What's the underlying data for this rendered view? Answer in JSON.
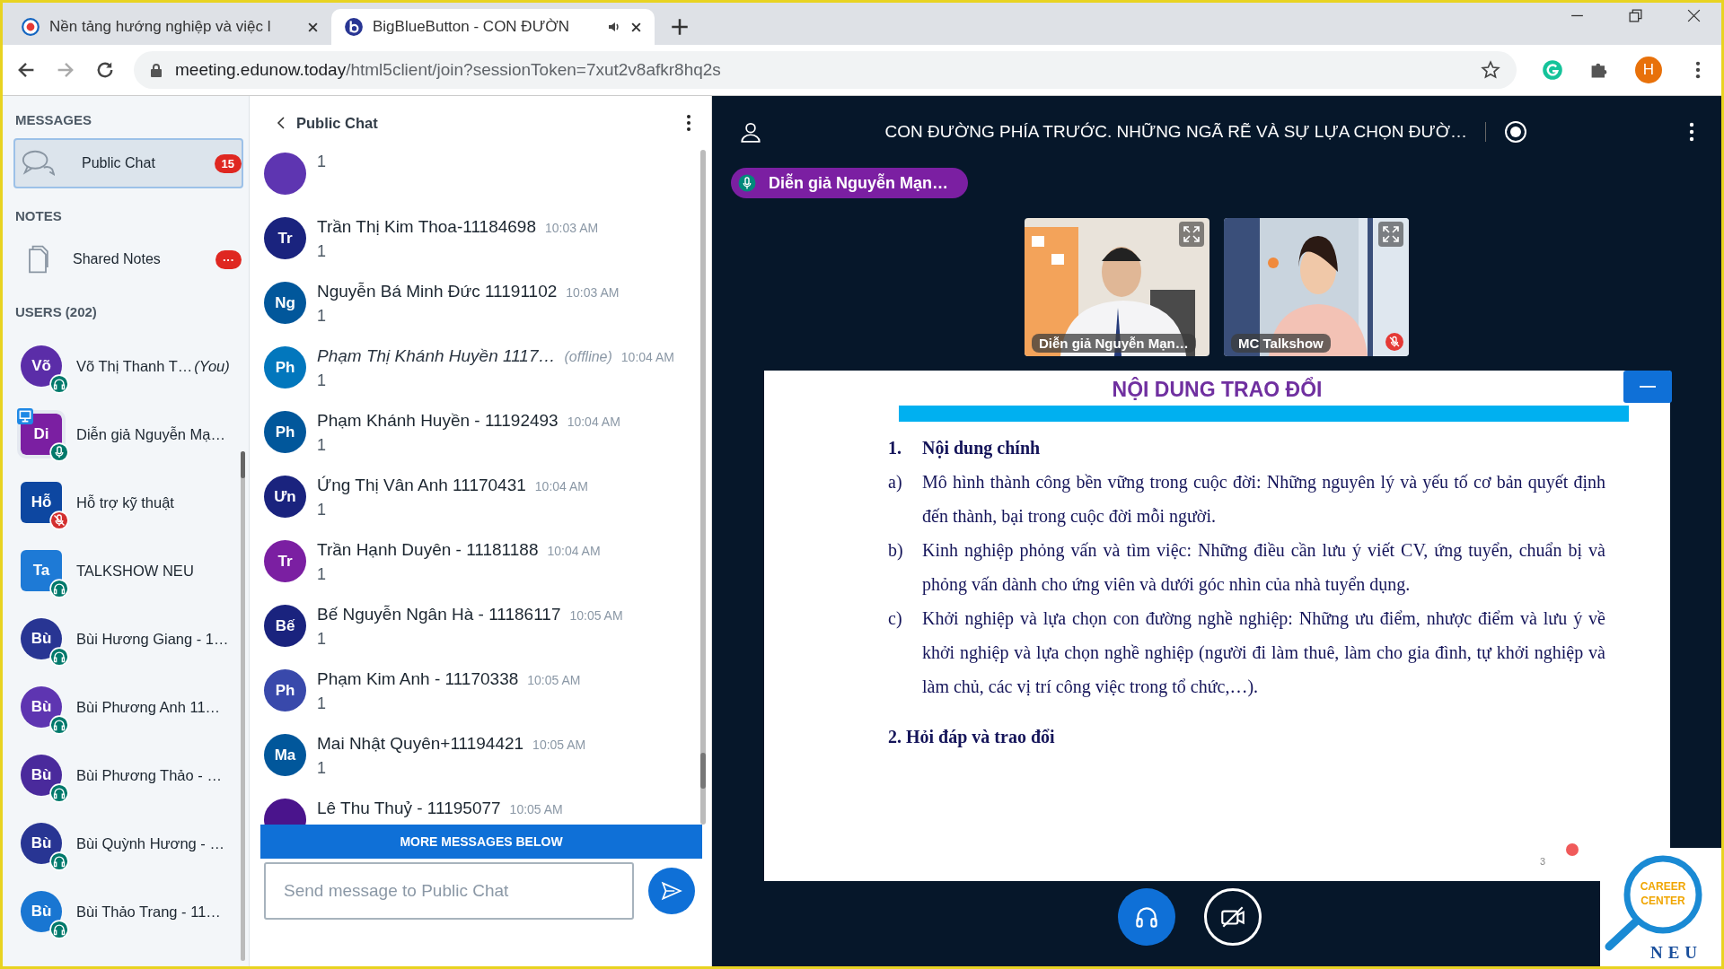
{
  "browser": {
    "tabs": [
      {
        "title": "Nền tảng hướng nghiệp và việc l",
        "selected": false,
        "audio": false
      },
      {
        "title": "BigBlueButton - CON ĐƯỜN",
        "selected": true,
        "audio": true
      }
    ],
    "url_host": "meeting.edunow.today",
    "url_path": "/html5client/join?sessionToken=7xut2v8afkr8hq2s",
    "profile": "H"
  },
  "sidebar": {
    "messages_heading": "MESSAGES",
    "public_chat": {
      "label": "Public Chat",
      "badge": "15",
      "selected": true
    },
    "notes_heading": "NOTES",
    "shared_notes": {
      "label": "Shared Notes",
      "badge": "···"
    },
    "users_heading": "USERS (202)",
    "users": [
      {
        "initials": "Võ",
        "name": "Võ Thị Thanh T…",
        "suffix": "(You)",
        "kind": "viewer",
        "listen_only": true,
        "muted": false,
        "presenter": false,
        "color": "#5b2da8"
      },
      {
        "initials": "Di",
        "name": "Diễn giả Nguyễn Mạ…",
        "kind": "moderator",
        "listen_only": false,
        "muted": false,
        "presenter": true,
        "color": "#7b1fa2"
      },
      {
        "initials": "Hỗ",
        "name": "Hỗ trợ kỹ thuật",
        "kind": "moderator",
        "listen_only": false,
        "muted": true,
        "presenter": false,
        "color": "#0d47a1"
      },
      {
        "initials": "Ta",
        "name": "TALKSHOW NEU",
        "kind": "moderator",
        "listen_only": true,
        "muted": false,
        "presenter": false,
        "color": "#1e7ad6"
      },
      {
        "initials": "Bù",
        "name": "Bùi Hương Giang - 1…",
        "kind": "viewer",
        "listen_only": true,
        "muted": false,
        "presenter": false,
        "color": "#283593"
      },
      {
        "initials": "Bù",
        "name": "Bùi Phương Anh 11…",
        "kind": "viewer",
        "listen_only": true,
        "muted": false,
        "presenter": false,
        "color": "#5e35b1"
      },
      {
        "initials": "Bù",
        "name": "Bùi Phương Thảo - …",
        "kind": "viewer",
        "listen_only": true,
        "muted": false,
        "presenter": false,
        "color": "#4a2a9c"
      },
      {
        "initials": "Bù",
        "name": "Bùi Quỳnh Hương - …",
        "kind": "viewer",
        "listen_only": true,
        "muted": false,
        "presenter": false,
        "color": "#283593"
      },
      {
        "initials": "Bù",
        "name": "Bùi Thảo Trang - 11…",
        "kind": "viewer",
        "listen_only": true,
        "muted": false,
        "presenter": false,
        "color": "#1976d2"
      }
    ]
  },
  "chat": {
    "title": "Public Chat",
    "messages": [
      {
        "text": "1",
        "color": "#5e35b1"
      },
      {
        "initials": "Tr",
        "name": "Trần Thị Kim Thoa-11184698",
        "time": "10:03 AM",
        "text": "1",
        "offline": false,
        "color": "#1a237e"
      },
      {
        "initials": "Ng",
        "name": "Nguyễn Bá Minh Đức 11191102",
        "time": "10:03 AM",
        "text": "1",
        "offline": false,
        "color": "#01579b"
      },
      {
        "initials": "Ph",
        "name": "Phạm Thị Khánh Huyền 1117…",
        "status": "(offline)",
        "time": "10:04 AM",
        "text": "1",
        "offline": true,
        "color": "#0277bd"
      },
      {
        "initials": "Ph",
        "name": "Phạm Khánh Huyền - 11192493",
        "time": "10:04 AM",
        "text": "1",
        "offline": false,
        "color": "#01579b"
      },
      {
        "initials": "Ưn",
        "name": "Ứng Thị Vân Anh 11170431",
        "time": "10:04 AM",
        "text": "1",
        "offline": false,
        "color": "#1a237e"
      },
      {
        "initials": "Tr",
        "name": "Trần Hạnh Duyên - 11181188",
        "time": "10:04 AM",
        "text": "1",
        "offline": false,
        "color": "#7b1fa2"
      },
      {
        "initials": "Bế",
        "name": "Bế Nguyễn Ngân Hà - 11186117",
        "time": "10:05 AM",
        "text": "1",
        "offline": false,
        "color": "#1a237e"
      },
      {
        "initials": "Ph",
        "name": "Phạm Kim Anh - 11170338",
        "time": "10:05 AM",
        "text": "1",
        "offline": false,
        "color": "#3949ab"
      },
      {
        "initials": "Ma",
        "name": "Mai Nhật Quyên+11194421",
        "time": "10:05 AM",
        "text": "1",
        "offline": false,
        "color": "#01579b"
      },
      {
        "name": "Lê Thu Thuỷ - 11195077",
        "time": "10:05 AM",
        "offline": false,
        "color": "#4a148c"
      }
    ],
    "more_below": "MORE MESSAGES BELOW",
    "input": {
      "placeholder": "Send message to Public Chat"
    }
  },
  "main": {
    "title": "CON ĐƯỜNG PHÍA TRƯỚC. NHỮNG NGÃ RẼ VÀ SỰ LỰA CHỌN ĐƯỜ…",
    "talker": "Diễn giả Nguyễn Mạn…",
    "videos": [
      {
        "label": "Diễn giả Nguyễn Mạn…",
        "muted": false,
        "kind": "picture"
      },
      {
        "label": "MC Talkshow",
        "muted": true,
        "kind": "picture"
      }
    ],
    "slide": {
      "title": "NỘI DUNG TRAO ĐỔI",
      "heading1": {
        "num": "1.",
        "text": "Nội dung chính"
      },
      "items": [
        {
          "mark": "a)",
          "text": "Mô hình thành công bền vững trong cuộc đời: Những nguyên lý và yếu tố cơ bản quyết định đến thành, bại trong cuộc đời mỗi người."
        },
        {
          "mark": "b)",
          "text": "Kinh nghiệp phỏng vấn và tìm việc: Những điều cần lưu ý viết CV, ứng tuyển, chuẩn bị và phỏng vấn dành cho ứng viên và dưới góc nhìn của nhà tuyển dụng."
        },
        {
          "mark": "c)",
          "text": "Khởi nghiệp và lựa chọn con đường nghề nghiệp: Những ưu điểm, nhược điểm và lưu ý về khởi nghiệp và lựa chọn nghề nghiệp (người đi làm thuê, làm cho gia đình, tự khởi nghiệp và làm chủ, các vị trí công việc trong tổ chức,…)."
        }
      ],
      "heading2": "2. Hỏi đáp và trao đổi",
      "page": "3"
    },
    "logo": {
      "line1": "CAREER",
      "line2": "CENTER",
      "line3": "NEU"
    }
  }
}
